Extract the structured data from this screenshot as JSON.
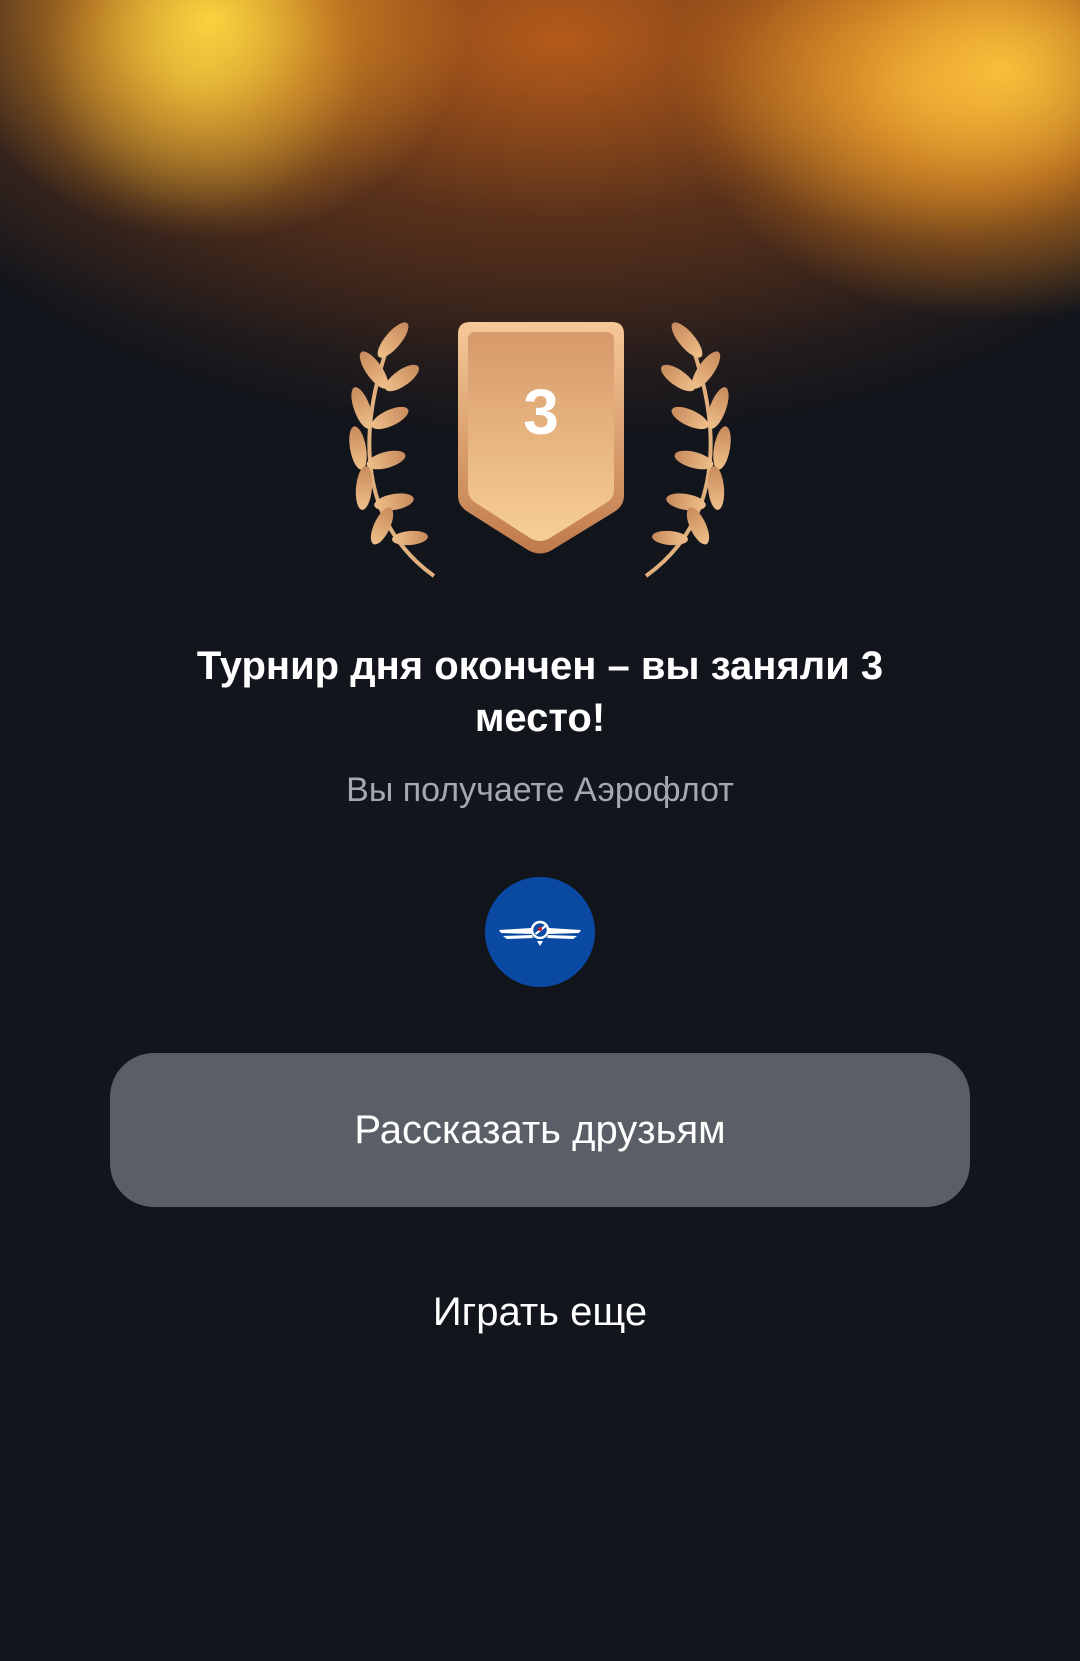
{
  "result": {
    "place_number": "3",
    "title": "Турнир дня окончен – вы заняли 3 место!",
    "subtitle": "Вы получаете Аэрофлот"
  },
  "partner": {
    "logo_icon": "aeroflot-winged-logo-icon",
    "logo_color": "#0b4aa2"
  },
  "actions": {
    "share_label": "Рассказать друзьям",
    "play_again_label": "Играть еще"
  },
  "colors": {
    "background": "#12151c",
    "bronze_light": "#f3c38b",
    "bronze_dark": "#c98a55",
    "button": "#5a5e66"
  }
}
